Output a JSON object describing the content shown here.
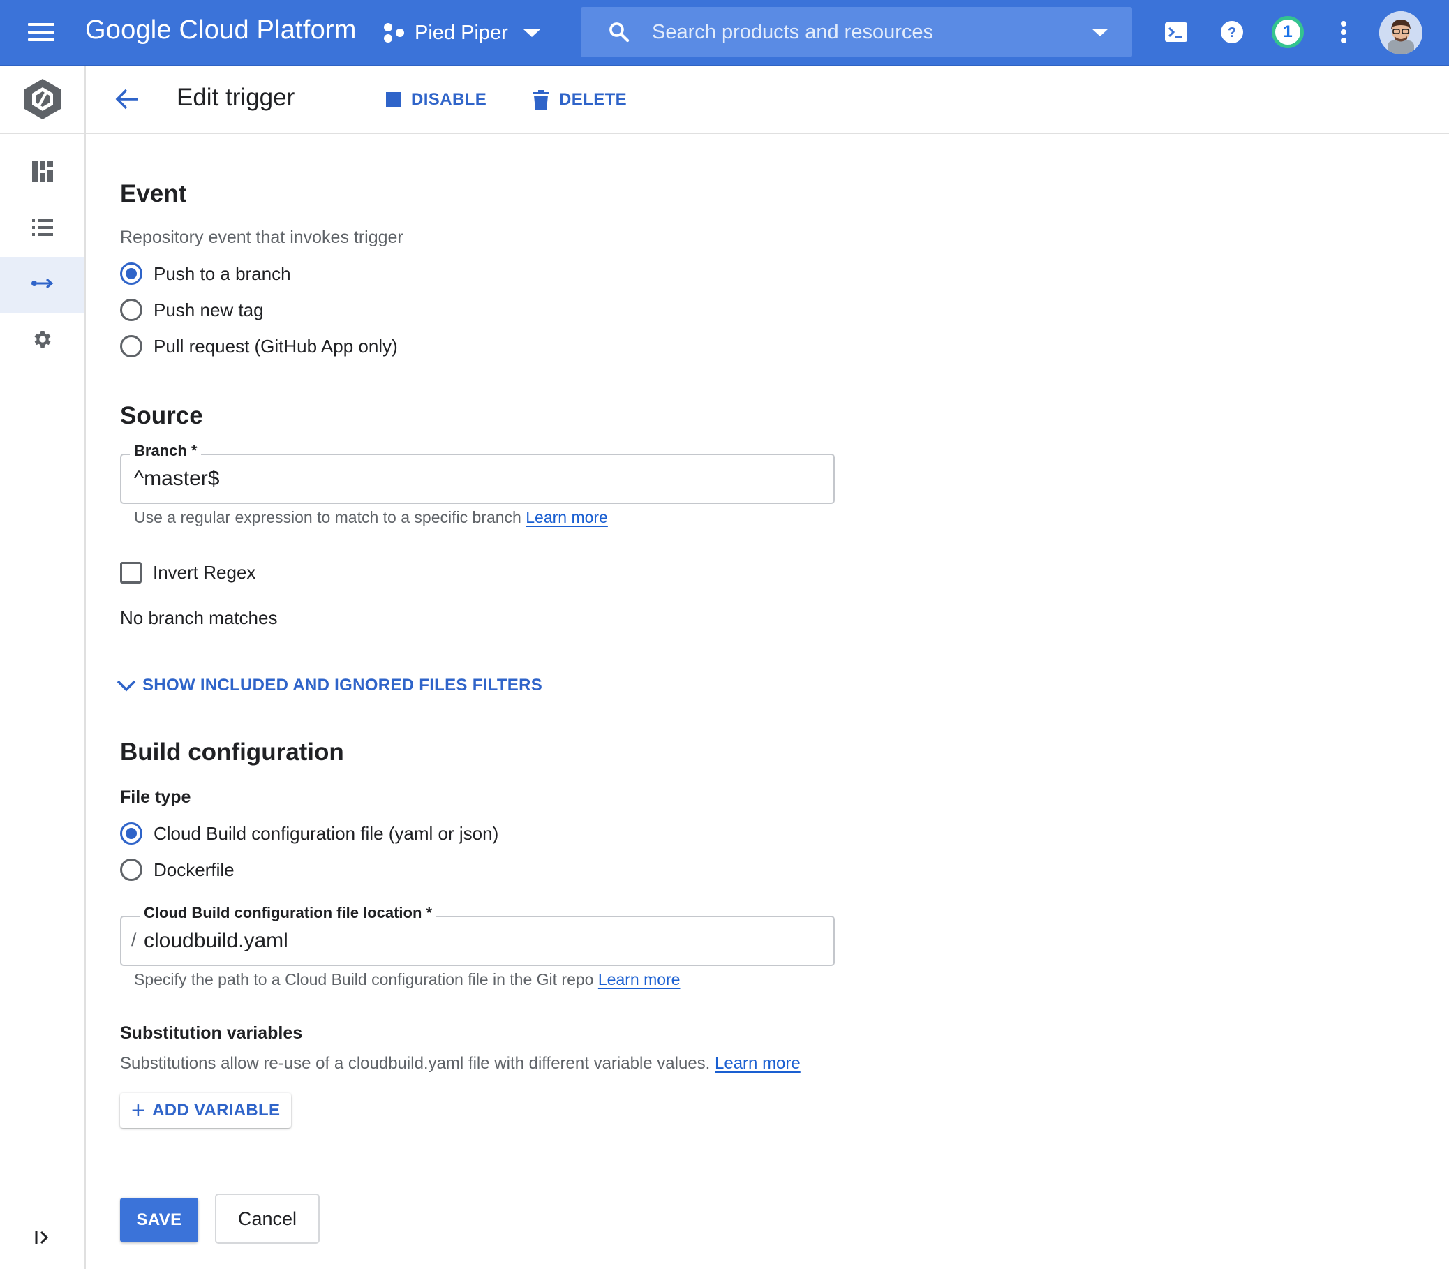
{
  "topbar": {
    "brand": "Google Cloud Platform",
    "project": "Pied Piper",
    "search_placeholder": "Search products and resources",
    "notification_count": "1",
    "accent_color": "#3b73d9"
  },
  "header": {
    "title": "Edit trigger",
    "disable_label": "DISABLE",
    "delete_label": "DELETE"
  },
  "leftnav": {
    "items": [
      {
        "icon": "dashboard-icon"
      },
      {
        "icon": "list-icon"
      },
      {
        "icon": "triggers-icon",
        "active": true
      },
      {
        "icon": "settings-gear-icon"
      }
    ]
  },
  "event": {
    "heading": "Event",
    "description": "Repository event that invokes trigger",
    "options": [
      {
        "label": "Push to a branch",
        "checked": true
      },
      {
        "label": "Push new tag",
        "checked": false
      },
      {
        "label": "Pull request (GitHub App only)",
        "checked": false
      }
    ]
  },
  "source": {
    "heading": "Source",
    "branch_label": "Branch *",
    "branch_value": "^master$",
    "branch_helper": "Use a regular expression to match to a specific branch",
    "learn_more": "Learn more",
    "invert_regex_label": "Invert Regex",
    "no_matches": "No branch matches",
    "show_filters_label": "SHOW INCLUDED AND IGNORED FILES FILTERS"
  },
  "build": {
    "heading": "Build configuration",
    "file_type_label": "File type",
    "options": [
      {
        "label": "Cloud Build configuration file (yaml or json)",
        "checked": true
      },
      {
        "label": "Dockerfile",
        "checked": false
      }
    ],
    "location_label": "Cloud Build configuration file location *",
    "location_prefix": "/",
    "location_value": "cloudbuild.yaml",
    "location_helper": "Specify the path to a Cloud Build configuration file in the Git repo",
    "learn_more": "Learn more"
  },
  "substitutions": {
    "heading": "Substitution variables",
    "description": "Substitutions allow re-use of a cloudbuild.yaml file with different variable values.",
    "learn_more": "Learn more",
    "add_variable_label": "ADD VARIABLE"
  },
  "actions": {
    "save_label": "SAVE",
    "cancel_label": "Cancel"
  }
}
